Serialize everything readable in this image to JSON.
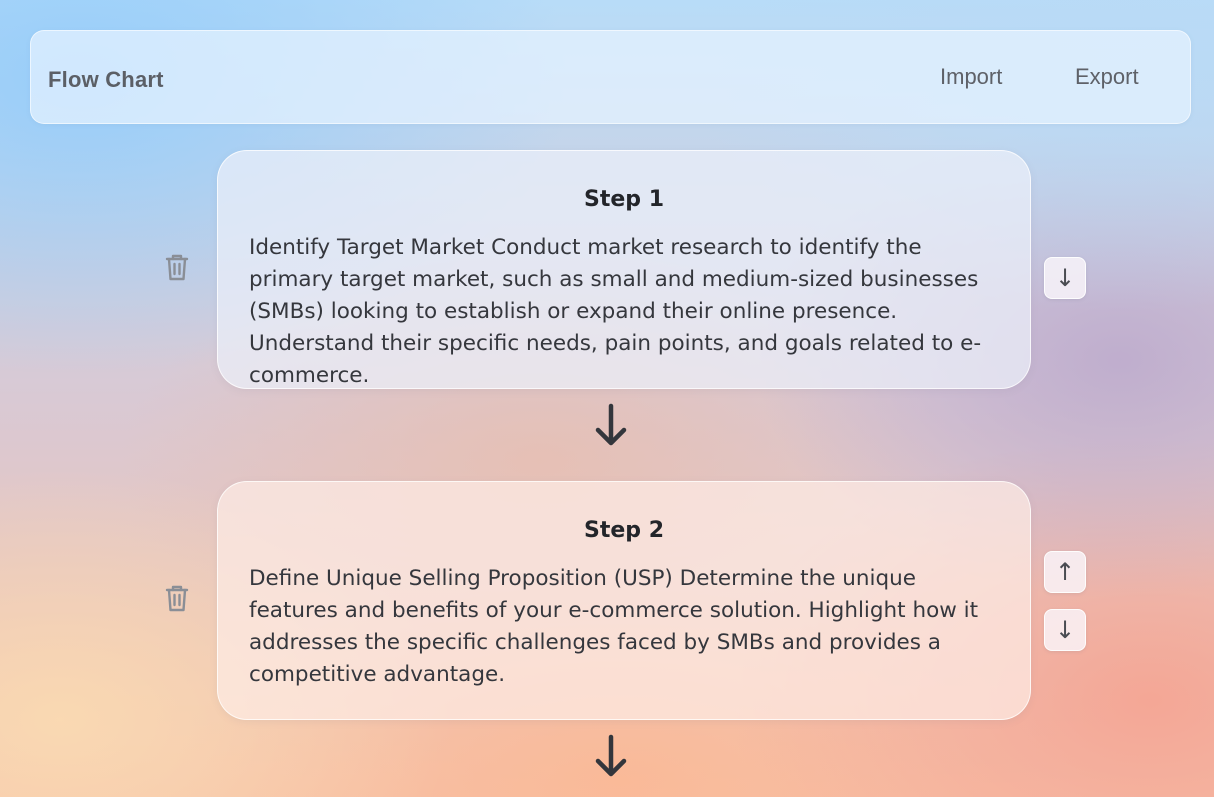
{
  "header": {
    "title": "Flow Chart",
    "import_label": "Import",
    "export_label": "Export"
  },
  "steps": [
    {
      "title": "Step 1",
      "text": "Identify Target Market Conduct market research to identify the primary target market, such as small and medium-sized businesses (SMBs) looking to establish or expand their online presence. Understand their specific needs, pain points, and goals related to e-commerce.",
      "controls": {
        "down": "↓"
      }
    },
    {
      "title": "Step 2",
      "text": "Define Unique Selling Proposition (USP) Determine the unique features and benefits of your e-commerce solution. Highlight how it addresses the specific challenges faced by SMBs and provides a competitive advantage.",
      "controls": {
        "up": "↑",
        "down": "↓"
      }
    }
  ],
  "icons": {
    "delete": "trash-icon",
    "connector": "arrow-down-icon"
  },
  "colors": {
    "text": "#35373d",
    "icon_gray": "#8a8e96",
    "arrow": "#33363c"
  }
}
